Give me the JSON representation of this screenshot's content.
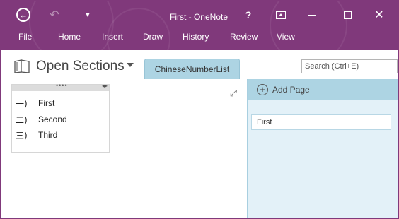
{
  "window": {
    "title": "First - OneNote",
    "accent_color": "#80397b",
    "section_color": "#add4e3",
    "pane_color": "#e3f1f8"
  },
  "titlebar": {
    "back_icon": "back-arrow-icon",
    "undo_icon": "undo-icon",
    "customize_icon": "customize-qat-icon",
    "help_label": "?",
    "fullscreen_icon": "full-page-view-icon",
    "minimize_icon": "minimize-icon",
    "maximize_icon": "maximize-icon",
    "close_label": "✕"
  },
  "ribbon": {
    "tabs": [
      "File",
      "Home",
      "Insert",
      "Draw",
      "History",
      "Review",
      "View"
    ]
  },
  "notebook": {
    "title": "Open Sections",
    "section_tab": "ChineseNumberList",
    "search_placeholder": "Search (Ctrl+E)"
  },
  "note": {
    "grip": "••••",
    "arrows": "◂▸",
    "items": [
      {
        "num": "一)",
        "text": "First"
      },
      {
        "num": "二)",
        "text": "Second"
      },
      {
        "num": "三)",
        "text": "Third"
      }
    ]
  },
  "canvas": {
    "expand_label": "⤢"
  },
  "pages": {
    "add_label": "Add Page",
    "add_icon": "plus-circle-icon",
    "items": [
      "First"
    ]
  }
}
